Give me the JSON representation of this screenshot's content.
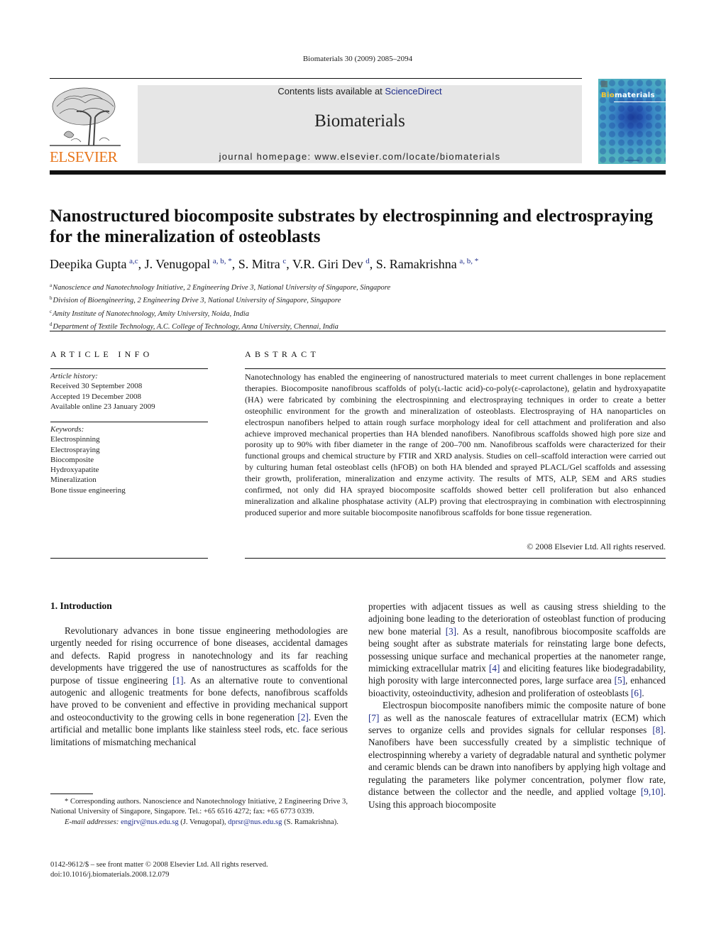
{
  "journal_ref": "Biomaterials 30 (2009) 2085–2094",
  "header": {
    "publisher_logo": "ELSEVIER",
    "contents_prefix": "Contents lists available at ",
    "contents_link": "ScienceDirect",
    "journal_name": "Biomaterials",
    "homepage": "journal homepage: www.elsevier.com/locate/biomaterials",
    "cover_title_accent": "Bio",
    "cover_title_rest": "materials"
  },
  "colors": {
    "elsevier_orange": "#e8751a",
    "link_blue": "#1f2d8a",
    "header_box_gray": "#e6e6e6"
  },
  "article": {
    "title": "Nanostructured biocomposite substrates by electrospinning and electrospraying for the mineralization of osteoblasts",
    "authors": [
      {
        "name": "Deepika Gupta",
        "sup": "a,c",
        "sep": ", "
      },
      {
        "name": "J. Venugopal",
        "sup": "a, b, *",
        "sep": ", "
      },
      {
        "name": "S. Mitra",
        "sup": "c",
        "sep": ", "
      },
      {
        "name": "V.R. Giri Dev",
        "sup": "d",
        "sep": ", "
      },
      {
        "name": "S. Ramakrishna",
        "sup": "a, b, *",
        "sep": ""
      }
    ],
    "affiliations": [
      {
        "mark": "a",
        "text": "Nanoscience and Nanotechnology Initiative, 2 Engineering Drive 3, National University of Singapore, Singapore"
      },
      {
        "mark": "b",
        "text": "Division of Bioengineering, 2 Engineering Drive 3, National University of Singapore, Singapore"
      },
      {
        "mark": "c",
        "text": "Amity Institute of Nanotechnology, Amity University, Noida, India"
      },
      {
        "mark": "d",
        "text": "Department of Textile Technology, A.C. College of Technology, Anna University, Chennai, India"
      }
    ]
  },
  "article_info": {
    "heading": "ARTICLE INFO",
    "history_label": "Article history:",
    "history": [
      "Received 30 September 2008",
      "Accepted 19 December 2008",
      "Available online 23 January 2009"
    ],
    "keywords_label": "Keywords:",
    "keywords": [
      "Electrospinning",
      "Electrospraying",
      "Biocomposite",
      "Hydroxyapatite",
      "Mineralization",
      "Bone tissue engineering"
    ]
  },
  "abstract": {
    "heading": "ABSTRACT",
    "text": "Nanotechnology has enabled the engineering of nanostructured materials to meet current challenges in bone replacement therapies. Biocomposite nanofibrous scaffolds of poly(ʟ-lactic acid)-co-poly(ε-capro­lactone), gelatin and hydroxyapatite (HA) were fabricated by combining the electrospinning and electrospraying techniques in order to create a better osteophilic environment for the growth and mineralization of osteoblasts. Electrospraying of HA nanoparticles on electrospun nanofibers helped to attain rough surface morphology ideal for cell attachment and proliferation and also achieve improved mechanical properties than HA blended nanofibers. Nanofibrous scaffolds showed high pore size and porosity up to 90% with fiber diameter in the range of 200–700 nm. Nanofibrous scaffolds were char­acterized for their functional groups and chemical structure by FTIR and XRD analysis. Studies on cell–scaffold interaction were carried out by culturing human fetal osteoblast cells (hFOB) on both HA blended and sprayed PLACL/Gel scaffolds and assessing their growth, proliferation, mineralization and enzyme activity. The results of MTS, ALP, SEM and ARS studies confirmed, not only did HA sprayed biocomposite scaffolds showed better cell proliferation but also enhanced mineralization and alkaline phosphatase activity (ALP) proving that electrospraying in combination with electrospinning produced superior and more suitable biocomposite nanofibrous scaffolds for bone tissue regeneration.",
    "copyright": "© 2008 Elsevier Ltd. All rights reserved."
  },
  "introduction": {
    "heading": "1.  Introduction",
    "col1": [
      {
        "t": "Revolutionary advances in bone tissue engineering methodolo­gies are urgently needed for rising occurrence of bone diseases, accidental damages and defects. Rapid progress in nanotechnology and its far reaching developments have triggered the use of nanostructures as scaffolds for the purpose of tissue engineering "
      },
      {
        "ref": "[1]"
      },
      {
        "t": ". As an alternative route to conventional autogenic and allogenic treatments for bone defects, nanofibrous scaffolds have proved to be convenient and effective in providing mechanical support and osteoconductivity to the growing cells in bone regeneration "
      },
      {
        "ref": "[2]"
      },
      {
        "t": ". Even the artificial and metallic bone implants like stainless steel rods, etc. face serious limitations of mismatching mechanical"
      }
    ],
    "col2_p1": [
      {
        "t": "properties with adjacent tissues as well as causing stress shielding to the adjoining bone leading to the deterioration of osteoblast function of producing new bone material "
      },
      {
        "ref": "[3]"
      },
      {
        "t": ". As a result, nano­fibrous biocomposite scaffolds are being sought after as substrate materials for reinstating large bone defects, possessing unique surface and mechanical properties at the nanometer range, mimicking extracellular matrix "
      },
      {
        "ref": "[4]"
      },
      {
        "t": " and eliciting features like biodegradability, high porosity with large interconnected pores, large surface area "
      },
      {
        "ref": "[5]"
      },
      {
        "t": ", enhanced bioactivity, osteoinductivity, adhesion and proliferation of osteoblasts "
      },
      {
        "ref": "[6]"
      },
      {
        "t": "."
      }
    ],
    "col2_p2": [
      {
        "t": "Electrospun biocomposite nanofibers mimic the composite nature of bone "
      },
      {
        "ref": "[7]"
      },
      {
        "t": " as well as the nanoscale features of extracellular matrix (ECM) which serves to organize cells and provides signals for cellular responses "
      },
      {
        "ref": "[8]"
      },
      {
        "t": ". Nanofibers have been successfully created by a simplistic technique of electrospinning whereby a variety of degradable natural and synthetic polymer and ceramic blends can be drawn into nanofibers by applying high voltage and regulating the parameters like polymer concentration, polymer flow rate, distance between the collector and the needle, and applied voltage "
      },
      {
        "ref": "[9,10]"
      },
      {
        "t": ". Using this approach biocomposite"
      }
    ]
  },
  "footnote": {
    "corresponding": "* Corresponding authors. Nanoscience and Nanotechnology Initiative, 2 Engi­neering Drive 3, National University of Singapore, Singapore. Tel.: +65 6516 4272; fax: +65 6773 0339.",
    "email_label": "E-mail addresses: ",
    "email1": "engjrv@nus.edu.sg",
    "email1_who": " (J. Venugopal), ",
    "email2": "dprsr@nus.edu.sg",
    "email2_who": " (S. Ramakrishna)."
  },
  "issn_line": "0142-9612/$ – see front matter © 2008 Elsevier Ltd. All rights reserved.",
  "doi_line": "doi:10.1016/j.biomaterials.2008.12.079"
}
